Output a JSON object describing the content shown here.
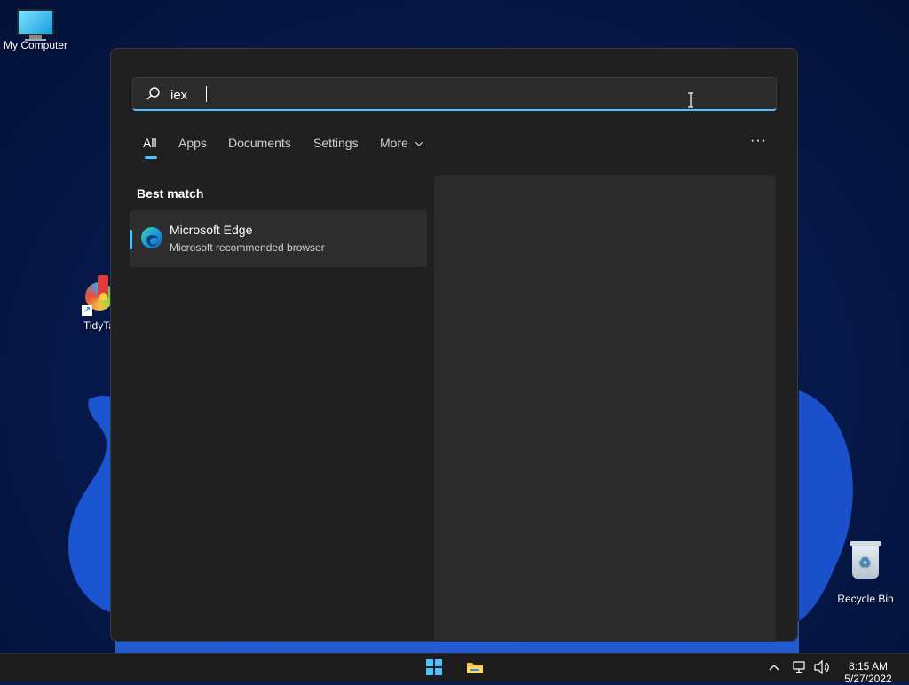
{
  "desktop": {
    "icons": [
      {
        "label": "My Computer",
        "icon": "monitor-icon"
      },
      {
        "label": "TidyTa",
        "icon": "tidytabs-icon"
      },
      {
        "label": "Recycle Bin",
        "icon": "recycle-bin-icon"
      }
    ]
  },
  "search": {
    "query": "iex",
    "icon": "search-icon",
    "tabs": [
      {
        "label": "All",
        "active": true
      },
      {
        "label": "Apps",
        "active": false
      },
      {
        "label": "Documents",
        "active": false
      },
      {
        "label": "Settings",
        "active": false
      },
      {
        "label": "More",
        "active": false
      }
    ],
    "options_label": "···",
    "best_match_header": "Best match",
    "best_match": {
      "title": "Microsoft Edge",
      "subtitle": "Microsoft recommended browser",
      "icon": "edge-icon"
    },
    "accent_color": "#4cc2ff"
  },
  "taskbar": {
    "pinned": [
      {
        "name": "Start",
        "icon": "windows-start-icon"
      },
      {
        "name": "File Explorer",
        "icon": "folder-icon"
      }
    ],
    "tray": {
      "chevron": "^",
      "time": "8:15 AM",
      "date": "5/27/2022"
    }
  }
}
